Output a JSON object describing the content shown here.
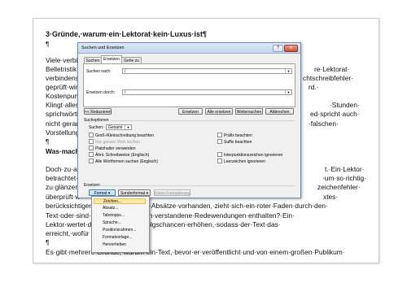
{
  "document": {
    "heading": "3·Gründe,·warum·ein·Lektorat·kein·Luxus·ist¶",
    "pilcrow": "¶",
    "left_fragments": [
      "Viele·verbin",
      "Belletristik",
      "verbindens",
      "geprüft·wird",
      "Kostenpunk",
      "Klingt·alles",
      "sprichwörtli",
      "nicht·gerade",
      "Vorstellung"
    ],
    "right_fragments": [
      "re·Lektorat·",
      "chtschreibfehler·",
      "rd.·",
      "·Stunden·",
      "ed·spricht·auch·",
      "·falschen·",
      "t.·Ein·Lektor·",
      "·um·so·richtig·",
      "zeichenfehler·",
      "xtes·"
    ],
    "was_macht": "Was·macht",
    "doch_lines": [
      "Doch·zu·alle",
      "betrachtet·b",
      "zu·glänzen.·",
      "überprüft·w"
    ],
    "line_beruck": "berücksichtigen,·ob·in·allen·Teilen·Absätze·vorhanden,·zieht·sich·ein·roter·Faden·durch·den·",
    "line_text": "Text·oder·sind·                   mulierungen,·falsch·verstandene·Redewendungen·enthalten?·Ein·",
    "line_lektor": "Lektor·wertet·d                   ·dass·sich·die·Erfolgschancen·erhöhen,·sodass·der·Text·das·",
    "line_erreicht": "erreicht,·wofür                   ·wurde.¶",
    "line_es_gibt": "Es·gibt·mehrere·Gründe,·warum·ein·Text,·bevor·er·veröffentlicht·und·von·einem·großen·Publikum·"
  },
  "dialog": {
    "title": "Suchen und Ersetzen",
    "help": "?",
    "close": "X",
    "tabs": [
      "Suchen",
      "Ersetzen",
      "Gehe zu"
    ],
    "search_label": "Suchen nach:",
    "search_value": "/",
    "replace_label": "Ersetzen durch:",
    "replace_value": "/",
    "btn_reduce": "<< Reduzieren",
    "btn_replace": "Ersetzen",
    "btn_replace_all": "Alle ersetzen",
    "btn_find_next": "Weitersuchen",
    "btn_cancel": "Abbrechen",
    "options_title": "Suchoptionen",
    "search_dir_label": "Suchen:",
    "search_dir_value": "Gesamt",
    "options_left": [
      "Groß-/Kleinschreibung beachten",
      "Nur ganzes Wort suchen",
      "Platzhalter verwenden",
      "Ähnl. Schreibweise (Englisch)",
      "Alle Wortformen suchen (Englisch)"
    ],
    "options_right": [
      "Präfix beachten",
      "Suffix beachten",
      "Interpunktionszeichen ignorieren",
      "Leerzeichen ignorieren"
    ],
    "replace_section": "Ersetzen",
    "btn_format": "Format ▾",
    "btn_special": "Sonderformat ▾",
    "btn_no_format": "Keine Formatierung"
  },
  "menu": {
    "items": [
      "Zeichen...",
      "Absatz...",
      "Tabstopps...",
      "Sprache...",
      "Positionsrahmen...",
      "Formatvorlage...",
      "Hervorheben"
    ]
  }
}
